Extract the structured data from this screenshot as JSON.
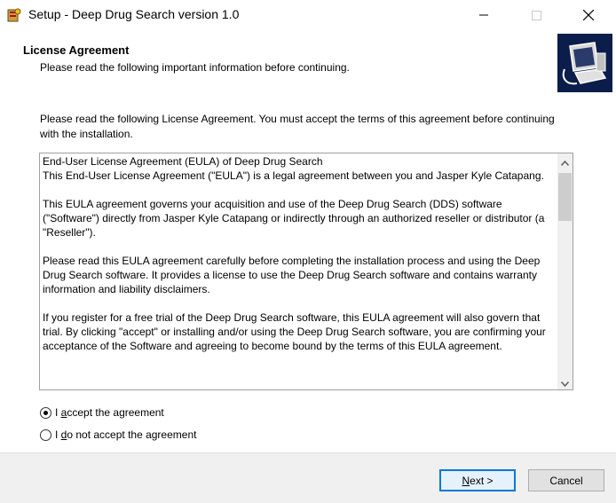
{
  "window": {
    "title": "Setup - Deep Drug Search version 1.0",
    "controls": [
      "minimize-icon",
      "maximize-icon",
      "close-icon"
    ]
  },
  "header": {
    "title": "License Agreement",
    "subtitle": "Please read the following important information before continuing."
  },
  "intro": "Please read the following License Agreement. You must accept the terms of this agreement before continuing with the installation.",
  "license": {
    "paragraphs": [
      "End-User License Agreement (EULA) of Deep Drug Search",
      "This End-User License Agreement (\"EULA\") is a legal agreement between you and Jasper Kyle Catapang.",
      "This EULA agreement governs your acquisition and use of the Deep Drug Search (DDS) software (\"Software\") directly from Jasper Kyle Catapang or indirectly through an authorized reseller or distributor (a \"Reseller\").",
      "Please read this EULA agreement carefully before completing the installation process and using the Deep Drug Search software. It provides a license to use the Deep Drug Search software and contains warranty information and liability disclaimers.",
      "If you register for a free trial of the Deep Drug Search software, this EULA agreement will also govern that trial. By clicking \"accept\" or installing and/or using the Deep Drug Search software, you are confirming your acceptance of the Software and agreeing to become bound by the terms of this EULA agreement."
    ]
  },
  "options": {
    "accept": {
      "pre": "I ",
      "key": "a",
      "post": "ccept the agreement",
      "selected": true
    },
    "decline": {
      "pre": "I ",
      "key": "d",
      "post": "o not accept the agreement",
      "selected": false
    }
  },
  "buttons": {
    "next": {
      "key": "N",
      "rest": "ext >"
    },
    "cancel": "Cancel"
  },
  "colors": {
    "focus_border": "#0078d7",
    "footer_bg": "#f0f0f0",
    "header_image_bg": "#0b1d4a"
  }
}
